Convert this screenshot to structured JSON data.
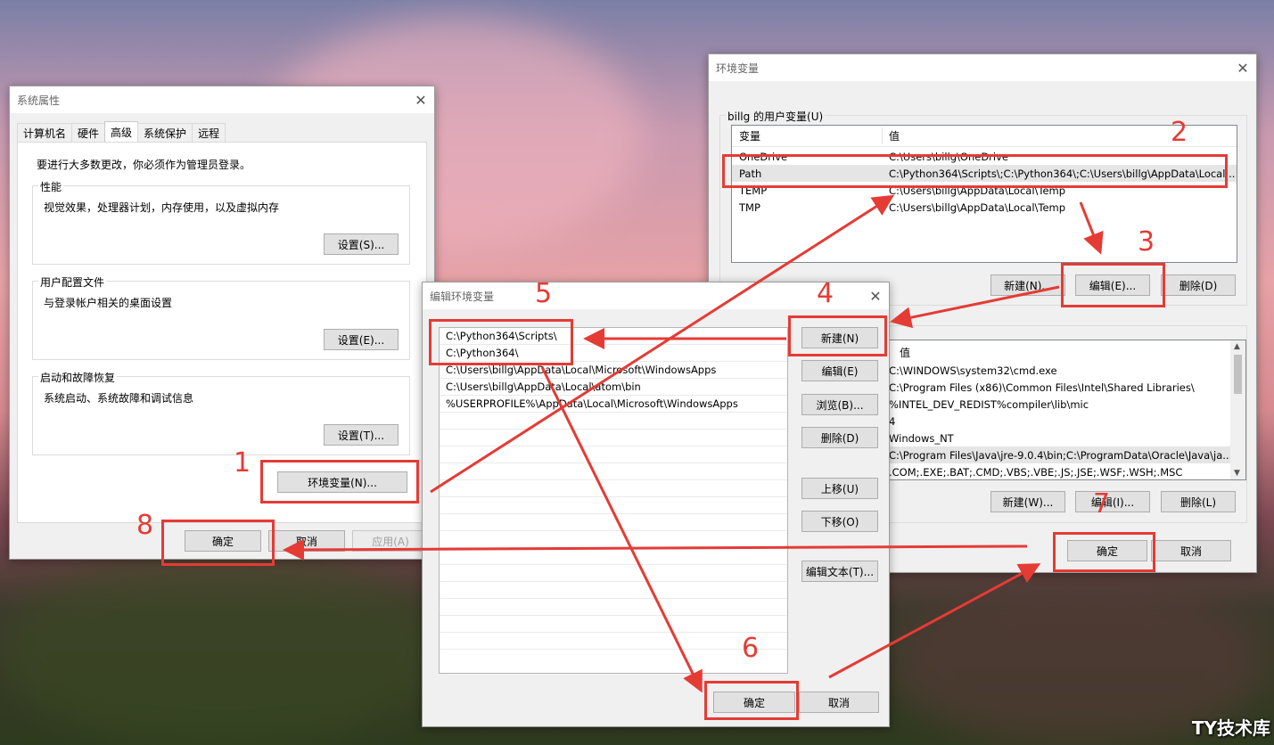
{
  "sysprops": {
    "title": "系统属性",
    "tabs": [
      "计算机名",
      "硬件",
      "高级",
      "系统保护",
      "远程"
    ],
    "admin_note": "要进行大多数更改，你必须作为管理员登录。",
    "perf": {
      "label": "性能",
      "desc": "视觉效果，处理器计划，内存使用，以及虚拟内存",
      "button": "设置(S)..."
    },
    "profile": {
      "label": "用户配置文件",
      "desc": "与登录帐户相关的桌面设置",
      "button": "设置(E)..."
    },
    "startup": {
      "label": "启动和故障恢复",
      "desc": "系统启动、系统故障和调试信息",
      "button": "设置(T)..."
    },
    "env_button": "环境变量(N)...",
    "ok": "确定",
    "cancel": "取消",
    "apply": "应用(A)"
  },
  "envvars": {
    "title": "环境变量",
    "user_group": "billg 的用户变量(U)",
    "col_var": "变量",
    "col_val": "值",
    "user_rows": [
      {
        "var": "OneDrive",
        "val": "C:\\Users\\billg\\OneDrive"
      },
      {
        "var": "Path",
        "val": "C:\\Python364\\Scripts\\;C:\\Python364\\;C:\\Users\\billg\\AppData\\Local..."
      },
      {
        "var": "TEMP",
        "val": "C:\\Users\\billg\\AppData\\Local\\Temp"
      },
      {
        "var": "TMP",
        "val": "C:\\Users\\billg\\AppData\\Local\\Temp"
      }
    ],
    "user_new": "新建(N)...",
    "user_edit": "编辑(E)...",
    "user_delete": "删除(D)",
    "sys_col_val": "值",
    "sys_rows": [
      "C:\\WINDOWS\\system32\\cmd.exe",
      "C:\\Program Files (x86)\\Common Files\\Intel\\Shared Libraries\\",
      "%INTEL_DEV_REDIST%compiler\\lib\\mic",
      "4",
      "Windows_NT",
      "C:\\Program Files\\Java\\jre-9.0.4\\bin;C:\\ProgramData\\Oracle\\Java\\ja...",
      ".COM;.EXE;.BAT;.CMD;.VBS;.VBE;.JS;.JSE;.WSF;.WSH;.MSC"
    ],
    "sys_new": "新建(W)...",
    "sys_edit": "编辑(I)...",
    "sys_delete": "删除(L)",
    "ok": "确定",
    "cancel": "取消"
  },
  "editenv": {
    "title": "编辑环境变量",
    "entries": [
      "C:\\Python364\\Scripts\\",
      "C:\\Python364\\",
      "C:\\Users\\billg\\AppData\\Local\\Microsoft\\WindowsApps",
      "C:\\Users\\billg\\AppData\\Local\\atom\\bin",
      "%USERPROFILE%\\AppData\\Local\\Microsoft\\WindowsApps"
    ],
    "new": "新建(N)",
    "edit": "编辑(E)",
    "browse": "浏览(B)...",
    "delete": "删除(D)",
    "up": "上移(U)",
    "down": "下移(O)",
    "edit_text": "编辑文本(T)...",
    "ok": "确定",
    "cancel": "取消"
  },
  "annotations": [
    "1",
    "2",
    "3",
    "4",
    "5",
    "6",
    "7",
    "8"
  ],
  "watermark": "TY技术库",
  "colors": {
    "annotation": "#e53b35",
    "dialog_bg": "#f0f0f0"
  }
}
